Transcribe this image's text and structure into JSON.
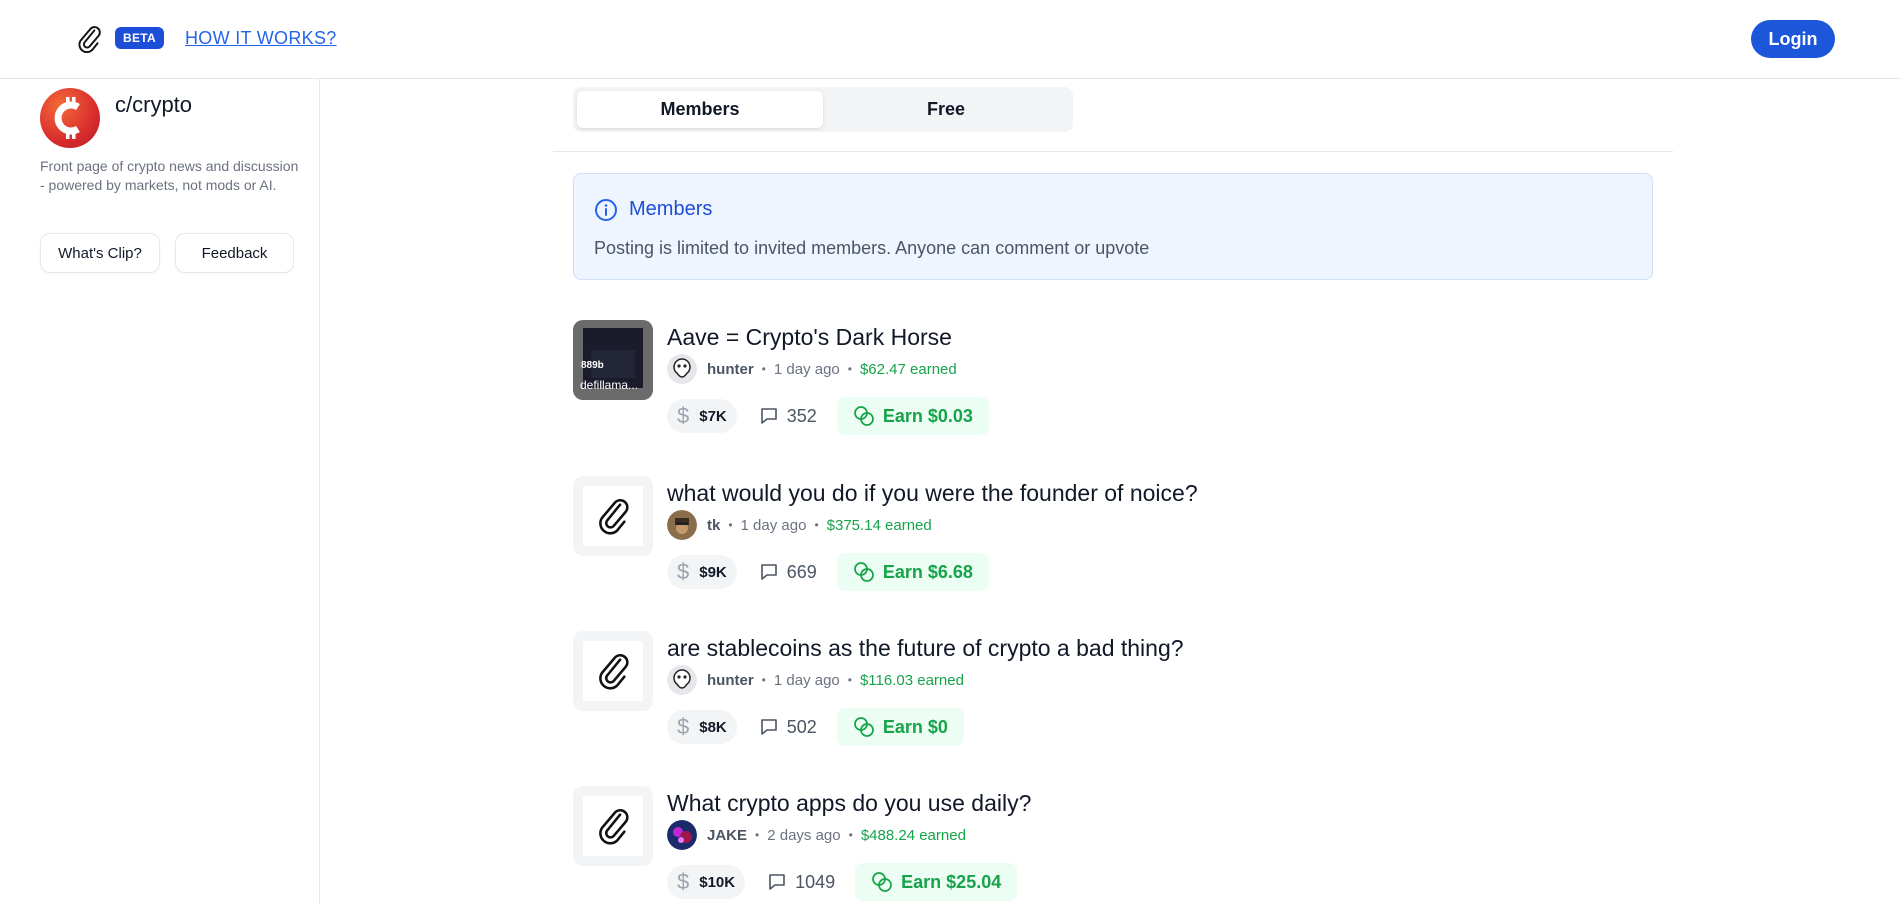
{
  "header": {
    "logo_icon": "paperclip-icon",
    "beta_label": "BETA",
    "how_it_works_label": "HOW IT WORKS?",
    "login_label": "Login",
    "accent_color": "#1d57d9"
  },
  "sidebar": {
    "community_name": "c/crypto",
    "community_icon": "bitcoin-icon",
    "description": "Front page of crypto news and discussion - powered by markets, not mods or AI.",
    "whats_clip_label": "What's Clip?",
    "feedback_label": "Feedback"
  },
  "tabs": [
    {
      "label": "Members",
      "active": true
    },
    {
      "label": "Free",
      "active": false
    }
  ],
  "info": {
    "icon": "info-icon",
    "title": "Members",
    "text": "Posting is limited to invited members. Anyone can comment or upvote"
  },
  "posts": [
    {
      "title": "Aave = Crypto's Dark Horse",
      "thumb_number": "889b",
      "thumb_caption": "defillama...",
      "user": "hunter",
      "time": "1 day ago",
      "earned": "$62.47 earned",
      "price": "$7K",
      "comments": "352",
      "earn": "Earn $0.03"
    },
    {
      "title": "what would you do if you were the founder of noice?",
      "user": "tk",
      "time": "1 day ago",
      "earned": "$375.14 earned",
      "price": "$9K",
      "comments": "669",
      "earn": "Earn $6.68"
    },
    {
      "title": "are stablecoins as the future of crypto a bad thing?",
      "user": "hunter",
      "time": "1 day ago",
      "earned": "$116.03 earned",
      "price": "$8K",
      "comments": "502",
      "earn": "Earn $0"
    },
    {
      "title": "What crypto apps do you use daily?",
      "user": "JAKE",
      "time": "2 days ago",
      "earned": "$488.24 earned",
      "price": "$10K",
      "comments": "1049",
      "earn": "Earn $25.04"
    }
  ],
  "colors": {
    "earned_green": "#16a34a",
    "info_blue": "#1d4ed8"
  }
}
